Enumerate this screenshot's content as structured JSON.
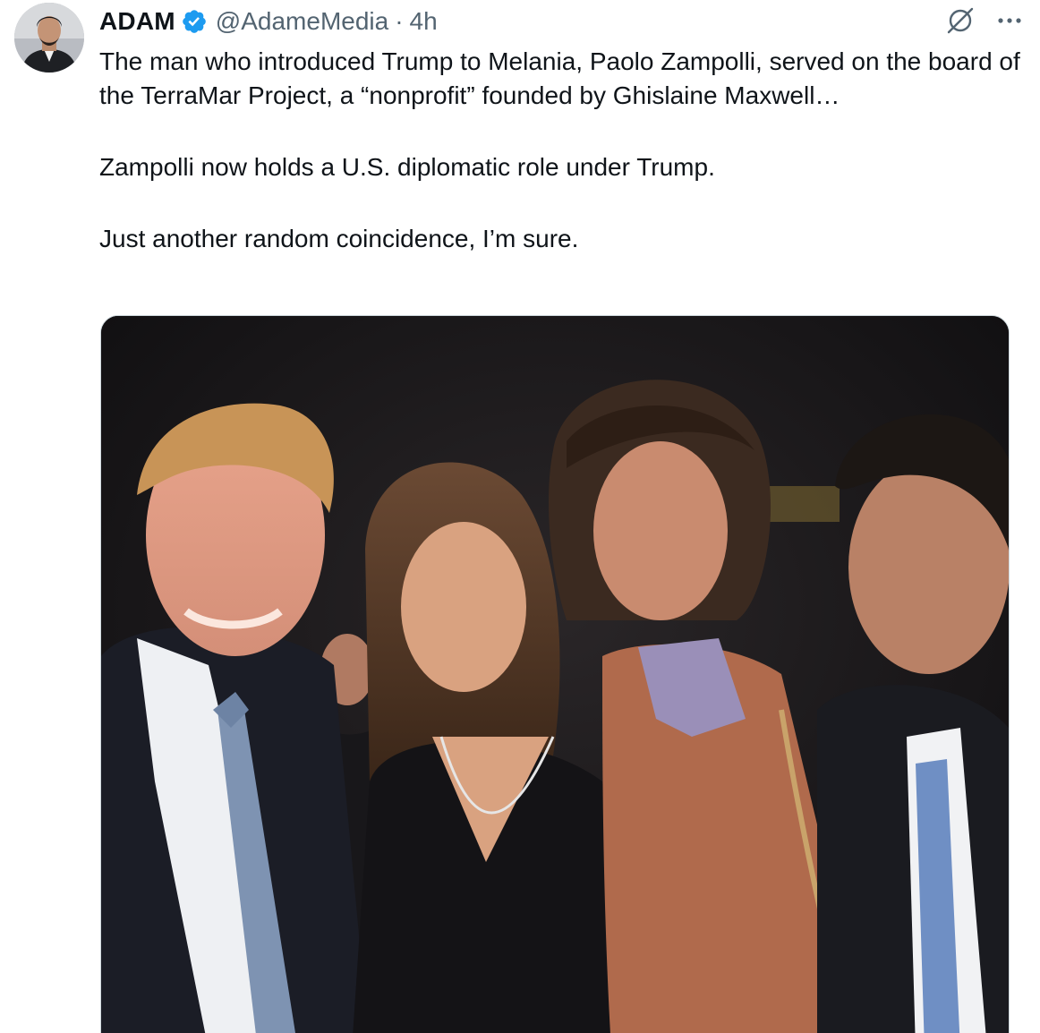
{
  "author": {
    "display_name": "ADAM",
    "handle": "@AdameMedia",
    "separator": "·",
    "time": "4h",
    "verified": true,
    "verified_color": "#1d9bf0"
  },
  "tweet": {
    "paragraphs": [
      "The man who introduced Trump to Melania, Paolo Zampolli, served on the board of the TerraMar Project, a “nonprofit” founded by Ghislaine Maxwell…",
      "Zampolli now holds a U.S. diplomatic role under Trump.",
      "Just another random coincidence, I’m sure."
    ]
  },
  "actions": {
    "grok_icon": "grok-icon",
    "more_icon": "more-icon"
  },
  "media": {
    "type": "photo",
    "icon": "photo-icon"
  },
  "colors": {
    "text": "#0f1419",
    "secondary": "#536471",
    "border": "#cfd9de"
  }
}
